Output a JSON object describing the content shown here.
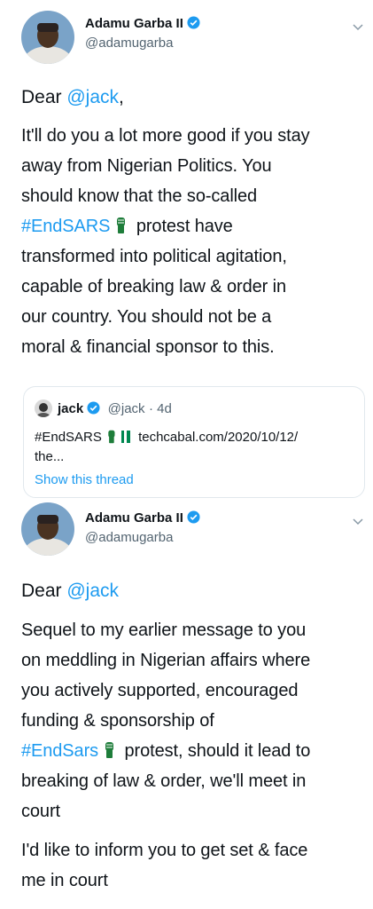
{
  "tweet1": {
    "author_name": "Adamu Garba II",
    "author_handle": "@adamugarba",
    "greeting_prefix": "Dear ",
    "greeting_mention": "@jack",
    "greeting_suffix": ",",
    "line1": "It'll do you a lot more good if you stay",
    "line2": "away from Nigerian Politics. You",
    "line3": "should know that the so-called",
    "hashtag": "#EndSARS",
    "line4_rest": " protest have",
    "line5": "transformed into political agitation,",
    "line6": "capable of breaking law & order in",
    "line7": "our country. You should not be a",
    "line8": "moral & financial sponsor to this."
  },
  "quoted": {
    "author_name": "jack",
    "author_handle": "@jack",
    "time": "· 4d",
    "hashtag": "#EndSARS",
    "link": "techcabal.com/2020/10/12/",
    "ellipsis": "the...",
    "show_thread": "Show this thread"
  },
  "tweet2": {
    "author_name": "Adamu Garba II",
    "author_handle": "@adamugarba",
    "greeting_prefix": "Dear ",
    "greeting_mention": "@jack",
    "line1": "Sequel to my earlier message to you",
    "line2": "on meddling in Nigerian affairs where",
    "line3": "you actively supported, encouraged",
    "line4": "funding & sponsorship of",
    "hashtag": "#EndSars",
    "line5_rest": " protest, should it lead to",
    "line6": "breaking of law & order, we'll meet in",
    "line7": "court",
    "line8": "I'd like to inform you to get set & face",
    "line9": "me in court"
  },
  "icons": {
    "verified": "verified-badge-icon",
    "chevron": "chevron-down-icon",
    "fist": "raised-fist-icon",
    "flag": "nigeria-flag-icon"
  },
  "colors": {
    "link": "#1d9bf0",
    "secondary_text": "#536471",
    "flag_green": "#008751",
    "fist_green": "#1e7d3a"
  }
}
